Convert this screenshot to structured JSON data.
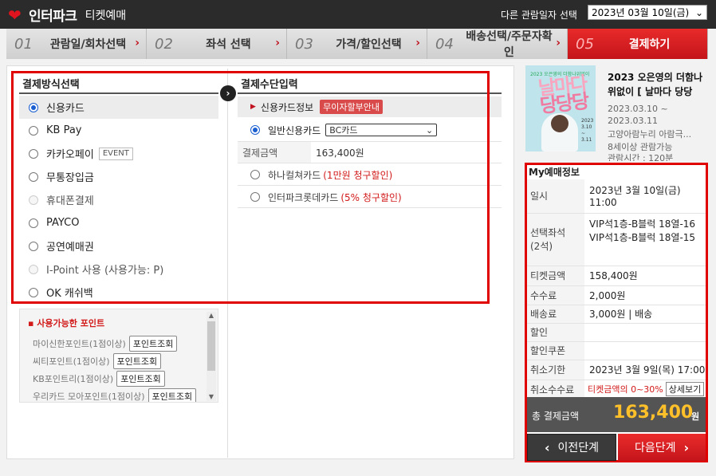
{
  "header": {
    "logo_main": "인터파크",
    "logo_sub": "티켓예매",
    "other_date_label": "다른 관람일자 선택",
    "date_select_value": "2023년 03월 10일(금)"
  },
  "steps": [
    {
      "num": "01",
      "label": "관람일/회차선택"
    },
    {
      "num": "02",
      "label": "좌석 선택"
    },
    {
      "num": "03",
      "label": "가격/할인선택"
    },
    {
      "num": "04",
      "label": "배송선택/주문자확인"
    },
    {
      "num": "05",
      "label": "결제하기"
    }
  ],
  "payment_method": {
    "title": "결제방식선택",
    "items": [
      "신용카드",
      "KB Pay",
      "카카오페이",
      "무통장입금",
      "휴대폰결제",
      "PAYCO",
      "공연예매권",
      "I-Point 사용 (사용가능: P)",
      "OK 캐쉬백"
    ],
    "event_badge": "EVENT"
  },
  "points": {
    "title": "사용가능한 포인트",
    "rows": [
      {
        "label": "마이신한포인트(1점이상)",
        "btn": "포인트조회"
      },
      {
        "label": "씨티포인트(1점이상)",
        "btn": "포인트조회"
      },
      {
        "label": "KB포인트리(1점이상)",
        "btn": "포인트조회"
      },
      {
        "label": "우리카드 모아포인트(1점이상)",
        "btn": "포인트조회"
      }
    ]
  },
  "payment_input": {
    "title": "결제수단입력",
    "card_info_label": "신용카드정보",
    "no_interest_btn": "무이자할부안내",
    "general_card_label": "일반신용카드",
    "card_select_value": "BC카드",
    "amount_label": "결제금액",
    "amount_value": "163,400원",
    "promos": [
      {
        "name": "하나컬쳐카드",
        "benefit": "(1만원 청구할인)"
      },
      {
        "name": "인터파크롯데카드",
        "benefit": "(5% 청구할인)"
      }
    ]
  },
  "performance": {
    "title": "2023 오은영의 더함나위없이 [ 날마다 당당",
    "date_range_1": "2023.03.10 ~",
    "date_range_2": "2023.03.11",
    "venue": "고양아람누리 아람극...",
    "age": "8세이상 관람가능",
    "runtime": "관람시간 : 120분",
    "poster_title_1": "날마다",
    "poster_title_2": "당당당",
    "poster_top": "2023 오은영의 더함나위없이",
    "poster_side": "2023 3.10 ~ 3.11"
  },
  "reservation": {
    "title": "My예매정보",
    "rows": [
      {
        "key": "일시",
        "value": "2023년 3월 10일(금)",
        "value2": "11:00"
      },
      {
        "key": "선택좌석",
        "key2": "(2석)",
        "value": "VIP석1층-B블럭 18열-16",
        "value2": "VIP석1층-B블럭 18열-15"
      },
      {
        "key": "티켓금액",
        "value": "158,400원"
      },
      {
        "key": "수수료",
        "value": "2,000원"
      },
      {
        "key": "배송료",
        "value": "3,000원 | 배송"
      },
      {
        "key": "할인",
        "value": ""
      },
      {
        "key": "할인쿠폰",
        "value": ""
      },
      {
        "key": "취소기한",
        "value": "2023년 3월 9일(목) 17:00"
      },
      {
        "key": "취소수수료",
        "value": "티켓금액의 0~30%",
        "btn": "상세보기"
      }
    ],
    "total_label": "총 결제금액",
    "total_value": "163,400",
    "total_unit": "원"
  },
  "nav": {
    "prev": "이전단계",
    "next": "다음단계"
  },
  "colors": {
    "brand_red": "#e0141e",
    "accent_red": "#d21a1a",
    "total_yellow": "#ffc02a"
  }
}
